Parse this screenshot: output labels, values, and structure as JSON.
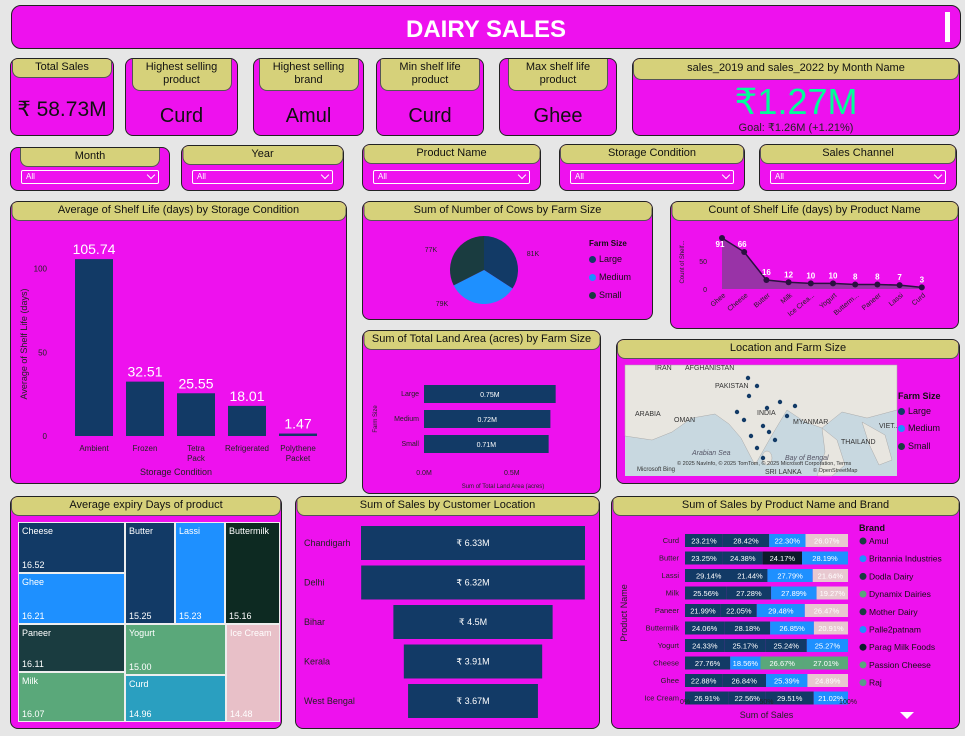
{
  "title": "DAIRY SALES",
  "kpis": [
    {
      "label": "Total Sales",
      "value": "₹ 58.73M"
    },
    {
      "label": "Highest selling product",
      "value": "Curd"
    },
    {
      "label": "Highest selling brand",
      "value": "Amul"
    },
    {
      "label": "Min shelf life product",
      "value": "Curd"
    },
    {
      "label": "Max shelf life product",
      "value": "Ghee"
    }
  ],
  "growth_card": {
    "title": "sales_2019 and sales_2022 by Month Name",
    "value": "₹1.27M",
    "goal": "Goal: ₹1.26M (+1.21%)"
  },
  "slicers": [
    {
      "label": "Month",
      "value": "All"
    },
    {
      "label": "Year",
      "value": "All"
    },
    {
      "label": "Product Name",
      "value": "All"
    },
    {
      "label": "Storage Condition",
      "value": "All"
    },
    {
      "label": "Sales Channel",
      "value": "All"
    }
  ],
  "colors": {
    "panel": "#ee11ee",
    "header": "#d6d17a",
    "navy": "#123a66",
    "large": "#123a66",
    "medium": "#1e90ff",
    "small": "#1a3c40",
    "title_green": "#00ff99"
  },
  "shelf_storage": {
    "title": "Average of Shelf Life (days) by Storage Condition",
    "ylabel": "Average of Shelf Life (days)",
    "xlabel": "Storage Condition",
    "yticks": [
      "100",
      "50",
      "0"
    ]
  },
  "cows": {
    "title": "Sum of Number of Cows by Farm Size",
    "legend_title": "Farm Size",
    "legend": [
      "Large",
      "Medium",
      "Small"
    ],
    "labels": [
      "81K",
      "79K",
      "77K"
    ]
  },
  "shelf_product": {
    "title": "Count of Shelf Life (days) by Product Name",
    "ylabel": "Count of Shelf..."
  },
  "land": {
    "title": "Sum of Total Land Area (acres) by Farm Size",
    "ylabel": "Farm Size",
    "xlabel": "Sum of Total Land Area (acres)",
    "xticks": [
      "0.0M",
      "0.5M"
    ]
  },
  "map": {
    "title": "Location and Farm Size",
    "legend_title": "Farm Size",
    "legend": [
      "Large",
      "Medium",
      "Small"
    ],
    "places": [
      "IRAN",
      "AFGHANISTAN",
      "PAKISTAN",
      "ARABIA",
      "OMAN",
      "INDIA",
      "MYANMAR",
      "THAILAND",
      "Arabian Sea",
      "Bay of Bengal",
      "SRI LANKA",
      "VIET..."
    ],
    "brand": "Microsoft Bing",
    "copyright": "© 2025 NavInfo, © 2025 TomTom, © 2025 Microsoft Corporation, Terms",
    "osm": "© OpenStreetMap"
  },
  "expiry": {
    "title": "Average expiry Days of product"
  },
  "location_sales": {
    "title": "Sum of Sales by Customer Location"
  },
  "brand_sales": {
    "title": "Sum of Sales by Product Name and Brand",
    "ylabel": "Product Name",
    "xlabel": "Sum of Sales",
    "xticks": [
      "0%",
      "50%",
      "100%"
    ],
    "legend_title": "Brand",
    "brands": [
      "Amul",
      "Britannia Industries",
      "Dodla Dairy",
      "Dynamix Dairies",
      "Mother Dairy",
      "Palle2patnam",
      "Parag Milk Foods",
      "Passion Cheese",
      "Raj"
    ],
    "brand_colors": [
      "#1a3c40",
      "#1e90ff",
      "#1a3c40",
      "#5aa87a",
      "#1a3c40",
      "#1e90ff",
      "#0d1b2a",
      "#5aa87a",
      "#5a9a8a"
    ]
  },
  "chart_data": [
    {
      "type": "bar",
      "title": "Average of Shelf Life (days) by Storage Condition",
      "categories": [
        "Ambient",
        "Frozen",
        "Tetra Pack",
        "Refrigerated",
        "Polythene Packet"
      ],
      "values": [
        105.74,
        32.51,
        25.55,
        18.01,
        1.47
      ],
      "labels": [
        "105.74",
        "32.51",
        "25.55",
        "18.01",
        "1.47"
      ],
      "xlabel": "Storage Condition",
      "ylabel": "Average of Shelf Life (days)",
      "ylim": [
        0,
        110
      ]
    },
    {
      "type": "pie",
      "title": "Sum of Number of Cows by Farm Size",
      "categories": [
        "Large",
        "Medium",
        "Small"
      ],
      "values": [
        81,
        79,
        77
      ],
      "labels": [
        "81K",
        "79K",
        "77K"
      ]
    },
    {
      "type": "area",
      "title": "Count of Shelf Life (days) by Product Name",
      "categories": [
        "Ghee",
        "Cheese",
        "Butter",
        "Milk",
        "Ice Crea...",
        "Yogurt",
        "Butterm...",
        "Paneer",
        "Lassi",
        "Curd"
      ],
      "values": [
        91,
        66,
        16,
        12,
        10,
        10,
        8,
        8,
        7,
        3
      ]
    },
    {
      "type": "bar",
      "title": "Sum of Total Land Area (acres) by Farm Size",
      "categories": [
        "Large",
        "Medium",
        "Small"
      ],
      "values": [
        0.75,
        0.72,
        0.71
      ],
      "labels": [
        "0.75M",
        "0.72M",
        "0.71M"
      ],
      "xlim": [
        0,
        0.9
      ]
    },
    {
      "type": "heatmap",
      "title": "Average expiry Days of product",
      "categories": [
        "Cheese",
        "Ghee",
        "Butter",
        "Lassi",
        "Buttermilk",
        "Paneer",
        "Yogurt",
        "Ice Cream",
        "Milk",
        "Curd"
      ],
      "values": [
        16.52,
        16.21,
        15.25,
        15.23,
        15.16,
        16.11,
        15.0,
        14.48,
        16.07,
        14.96
      ],
      "labels": [
        "16.52",
        "16.21",
        "15.25",
        "15.23",
        "15.16",
        "16.11",
        "15.00",
        "14.48",
        "16.07",
        "14.96"
      ]
    },
    {
      "type": "bar",
      "title": "Sum of Sales by Customer Location",
      "categories": [
        "Chandigarh",
        "Delhi",
        "Bihar",
        "Kerala",
        "West Bengal"
      ],
      "values": [
        6.33,
        6.32,
        4.5,
        3.91,
        3.67
      ],
      "labels": [
        "₹ 6.33M",
        "₹ 6.32M",
        "₹ 4.5M",
        "₹ 3.91M",
        "₹ 3.67M"
      ]
    },
    {
      "type": "bar",
      "title": "Sum of Sales by Product Name and Brand",
      "categories": [
        "Curd",
        "Butter",
        "Lassi",
        "Milk",
        "Paneer",
        "Buttermilk",
        "Yogurt",
        "Cheese",
        "Ghee",
        "Ice Cream"
      ],
      "rows": [
        [
          "23.21%",
          "28.42%",
          "22.30%",
          "26.07%"
        ],
        [
          "23.25%",
          "24.38%",
          "24.17%",
          "28.19%"
        ],
        [
          "29.14%",
          "21.44%",
          "27.79%",
          "21.64%"
        ],
        [
          "25.56%",
          "27.28%",
          "27.89%",
          "19.27%"
        ],
        [
          "21.99%",
          "22.05%",
          "29.48%",
          "26.47%"
        ],
        [
          "24.06%",
          "28.18%",
          "26.85%",
          "20.91%"
        ],
        [
          "24.33%",
          "25.17%",
          "25.24%",
          "25.27%"
        ],
        [
          "27.76%",
          "18.56%",
          "26.67%",
          "27.01%"
        ],
        [
          "22.88%",
          "26.84%",
          "25.39%",
          "24.89%"
        ],
        [
          "26.91%",
          "22.56%",
          "29.51%",
          "21.02%"
        ]
      ],
      "row_colors": [
        [
          "#123a66",
          "#123a66",
          "#1e90ff",
          "#e8c8d0"
        ],
        [
          "#123a66",
          "#123a66",
          "#0d1b2a",
          "#1e90ff"
        ],
        [
          "#123a66",
          "#123a66",
          "#1e90ff",
          "#e8c8d0"
        ],
        [
          "#123a66",
          "#123a66",
          "#1e90ff",
          "#e8c8d0"
        ],
        [
          "#123a66",
          "#123a66",
          "#1e90ff",
          "#e8c8d0"
        ],
        [
          "#123a66",
          "#123a66",
          "#1e90ff",
          "#e8c8d0"
        ],
        [
          "#123a66",
          "#123a66",
          "#123a66",
          "#1e90ff"
        ],
        [
          "#123a66",
          "#1e90ff",
          "#5aa87a",
          "#5aa87a"
        ],
        [
          "#123a66",
          "#123a66",
          "#1e90ff",
          "#e8c8d0"
        ],
        [
          "#123a66",
          "#123a66",
          "#123a66",
          "#1e90ff"
        ]
      ]
    }
  ]
}
